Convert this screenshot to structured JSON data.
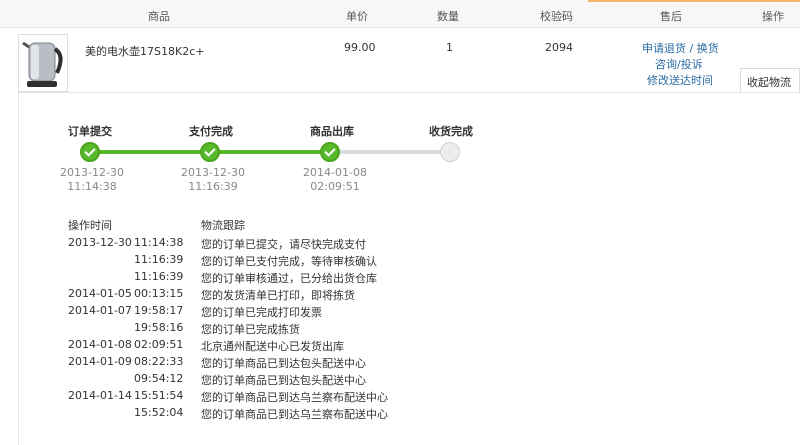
{
  "columns": {
    "product": "商品",
    "price": "单价",
    "qty": "数量",
    "verify_code": "校验码",
    "after_sale": "售后",
    "action": "操作"
  },
  "product": {
    "name": "美的电水壶17S18K2c+",
    "price": "99.00",
    "qty": "1",
    "verify_code": "2094",
    "links": [
      "申请退货 / 换货",
      "咨询/投诉",
      "修改送达时间"
    ],
    "collapse_label": "收起物流"
  },
  "progress": {
    "completed_steps": 3,
    "total_steps": 4,
    "steps": [
      {
        "label": "订单提交",
        "date": "2013-12-30",
        "time": "11:14:38"
      },
      {
        "label": "支付完成",
        "date": "2013-12-30",
        "time": "11:16:39"
      },
      {
        "label": "商品出库",
        "date": "2014-01-08",
        "time": "02:09:51"
      },
      {
        "label": "收货完成",
        "date": "",
        "time": ""
      }
    ]
  },
  "log": {
    "col_time": "操作时间",
    "col_track": "物流跟踪",
    "rows": [
      {
        "date": "2013-12-30",
        "time": "11:14:38",
        "msg": "您的订单已提交，请尽快完成支付"
      },
      {
        "date": "",
        "time": "11:16:39",
        "msg": "您的订单已支付完成，等待审核确认"
      },
      {
        "date": "",
        "time": "11:16:39",
        "msg": "您的订单审核通过，已分给出货仓库"
      },
      {
        "date": "2014-01-05",
        "time": "00:13:15",
        "msg": "您的发货清单已打印，即将拣货"
      },
      {
        "date": "2014-01-07",
        "time": "19:58:17",
        "msg": "您的订单已完成打印发票"
      },
      {
        "date": "",
        "time": "19:58:16",
        "msg": "您的订单已完成拣货"
      },
      {
        "date": "2014-01-08",
        "time": "02:09:51",
        "msg": "北京通州配送中心已发货出库"
      },
      {
        "date": "2014-01-09",
        "time": "08:22:33",
        "msg": "您的订单商品已到达包头配送中心"
      },
      {
        "date": "",
        "time": "09:54:12",
        "msg": "您的订单商品已到达包头配送中心"
      },
      {
        "date": "2014-01-14",
        "time": "15:51:54",
        "msg": "您的订单商品已到达乌兰察布配送中心"
      },
      {
        "date": "",
        "time": "15:52:04",
        "msg": "您的订单商品已到达乌兰察布配送中心"
      }
    ]
  },
  "colors": {
    "accent_green": "#58b92b",
    "link_blue": "#2b6aa3",
    "header_accent": "#f5b86a"
  }
}
